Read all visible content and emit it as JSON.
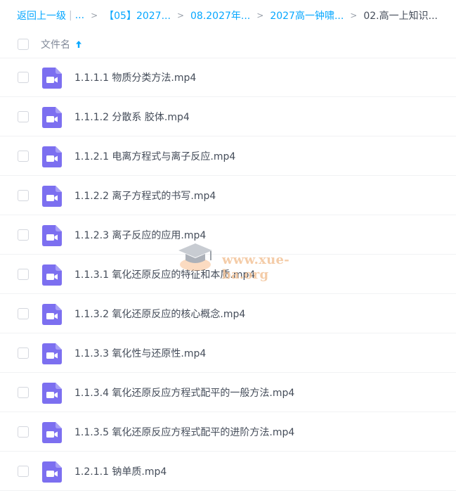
{
  "breadcrumb": {
    "back_label": "返回上一级",
    "separator": "|",
    "ellipsis": "...",
    "arrow": ">",
    "items": [
      "【05】2027...",
      "08.2027年...",
      "2027高一钟啸...",
      "02.高一上知识..."
    ]
  },
  "header": {
    "filename_label": "文件名",
    "sort_icon": "arrow-up-icon"
  },
  "files": [
    {
      "name": "1.1.1.1 物质分类方法.mp4",
      "icon": "video-file-icon"
    },
    {
      "name": "1.1.1.2 分散系 胶体.mp4",
      "icon": "video-file-icon"
    },
    {
      "name": "1.1.2.1 电离方程式与离子反应.mp4",
      "icon": "video-file-icon"
    },
    {
      "name": "1.1.2.2 离子方程式的书写.mp4",
      "icon": "video-file-icon"
    },
    {
      "name": "1.1.2.3 离子反应的应用.mp4",
      "icon": "video-file-icon"
    },
    {
      "name": "1.1.3.1 氧化还原反应的特征和本质.mp4",
      "icon": "video-file-icon"
    },
    {
      "name": "1.1.3.2 氧化还原反应的核心概念.mp4",
      "icon": "video-file-icon"
    },
    {
      "name": "1.1.3.3 氧化性与还原性.mp4",
      "icon": "video-file-icon"
    },
    {
      "name": "1.1.3.4 氧化还原反应方程式配平的一般方法.mp4",
      "icon": "video-file-icon"
    },
    {
      "name": "1.1.3.5 氧化还原反应方程式配平的进阶方法.mp4",
      "icon": "video-file-icon"
    },
    {
      "name": "1.2.1.1 钠单质.mp4",
      "icon": "video-file-icon"
    }
  ],
  "watermark": {
    "text": "www.xue-ba.org",
    "icon": "graduation-cap-icon"
  },
  "colors": {
    "link": "#06a7ff",
    "text": "#454d5a",
    "muted": "#818999",
    "video_icon": "#7c6ff0"
  }
}
